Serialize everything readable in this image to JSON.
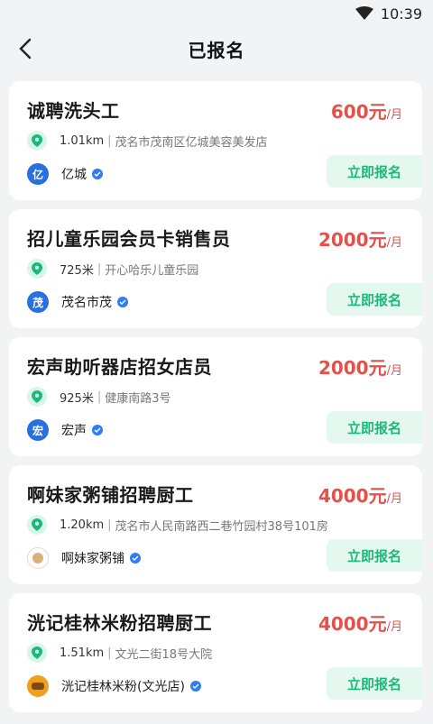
{
  "status_bar": {
    "time": "10:39",
    "wifi_icon": "wifi-icon"
  },
  "header": {
    "title": "已报名",
    "back_icon": "chevron-left-icon"
  },
  "jobs": [
    {
      "title": "诚聘洗头工",
      "salary_amount": "600元",
      "salary_unit": "/月",
      "distance": "1.01km",
      "address": "茂名市茂南区亿城美容美发店",
      "company_initial": "亿",
      "company": "亿城",
      "apply_label": "立即报名"
    },
    {
      "title": "招儿童乐园会员卡销售员",
      "salary_amount": "2000元",
      "salary_unit": "/月",
      "distance": "725米",
      "address": "开心哈乐儿童乐园",
      "company_initial": "茂",
      "company": "茂名市茂",
      "apply_label": "立即报名"
    },
    {
      "title": "宏声助听器店招女店员",
      "salary_amount": "2000元",
      "salary_unit": "/月",
      "distance": "925米",
      "address": "健康南路3号",
      "company_initial": "宏",
      "company": "宏声",
      "apply_label": "立即报名"
    },
    {
      "title": "啊妹家粥铺招聘厨工",
      "salary_amount": "4000元",
      "salary_unit": "/月",
      "distance": "1.20km",
      "address": "茂名市人民南路西二巷竹园村38号101房",
      "company_initial": "",
      "company": "啊妹家粥铺",
      "apply_label": "立即报名"
    },
    {
      "title": "洸记桂林米粉招聘厨工",
      "salary_amount": "4000元",
      "salary_unit": "/月",
      "distance": "1.51km",
      "address": "文光二街18号大院",
      "company_initial": "",
      "company": "洸记桂林米粉(文光店)",
      "apply_label": "立即报名"
    }
  ],
  "separator": "|",
  "colors": {
    "accent": "#19b97a",
    "salary": "#e0524b",
    "verified": "#2f7cf6"
  }
}
